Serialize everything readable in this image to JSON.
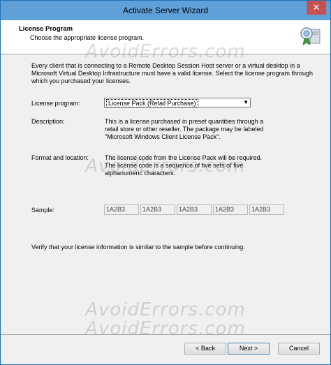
{
  "window": {
    "title": "Activate Server Wizard",
    "close_glyph": "✕"
  },
  "header": {
    "title": "License Program",
    "subtitle": "Choose the appropriate license program.",
    "icon": "certificate-server-icon"
  },
  "watermark": "AvoidErrors.com",
  "intro": "Every client that is connecting to a Remote Desktop Session Host server or a virtual desktop in a Microsoft Virtual Desktop Infrastructure must have a valid license. Select the license program through which you purchased your licenses.",
  "form": {
    "license_program_label": "License program:",
    "license_program_value": "License Pack (Retail Purchase)",
    "description_label": "Description:",
    "description_text": "This is a license purchased in preset quantities through a retail store or other reseller. The package may be labeled \"Microsoft Windows Client License Pack\".",
    "format_label": "Format and location:",
    "format_text": "The license code from the License Pack will be required. The license code is a sequence of five sets of five alphanumeric characters.",
    "sample_label": "Sample:",
    "sample_values": [
      "1A2B3",
      "1A2B3",
      "1A2B3",
      "1A2B3",
      "1A2B3"
    ]
  },
  "verify_text": "Verify that your license information is similar to the sample before continuing.",
  "buttons": {
    "back": "< Back",
    "next": "Next >",
    "cancel": "Cancel"
  }
}
